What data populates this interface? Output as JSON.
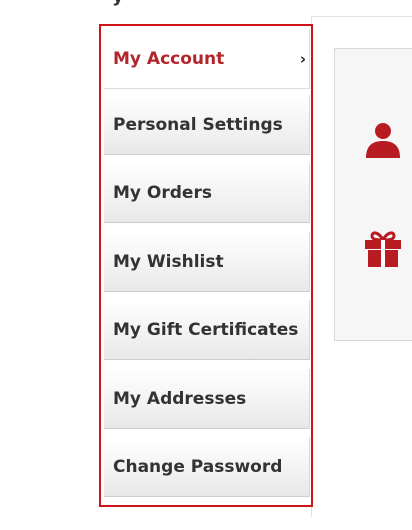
{
  "heading_fragment": "y",
  "sidebar": {
    "items": [
      {
        "label": "My Account",
        "active": true,
        "icon": "chevron-right-icon"
      },
      {
        "label": "Personal Settings",
        "active": false
      },
      {
        "label": "My Orders",
        "active": false
      },
      {
        "label": "My Wishlist",
        "active": false
      },
      {
        "label": "My Gift Certificates",
        "active": false
      },
      {
        "label": "My Addresses",
        "active": false
      },
      {
        "label": "Change Password",
        "active": false
      }
    ],
    "chevron_glyph": "›"
  },
  "content": {
    "icons": [
      "user-icon",
      "gift-icon"
    ]
  },
  "colors": {
    "accent": "#d0121a",
    "active_label": "#b1252b",
    "text": "#333333",
    "icon": "#b81b22"
  }
}
